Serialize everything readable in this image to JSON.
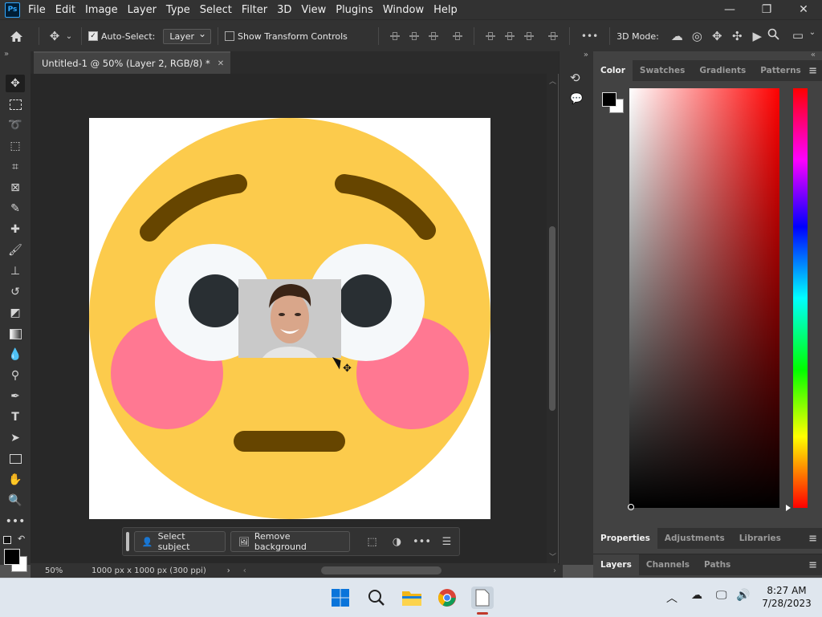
{
  "app": {
    "logo": "Ps",
    "menu": [
      "File",
      "Edit",
      "Image",
      "Layer",
      "Type",
      "Select",
      "Filter",
      "3D",
      "View",
      "Plugins",
      "Window",
      "Help"
    ],
    "window_controls": [
      "minimize-icon",
      "restore-icon",
      "close-icon"
    ]
  },
  "options_bar": {
    "auto_select_label": "Auto-Select:",
    "auto_select_checked": true,
    "auto_select_target": "Layer",
    "transform_controls_label": "Show Transform Controls",
    "transform_controls_checked": false,
    "more_label": "•••",
    "three_d_mode_label": "3D Mode:"
  },
  "document": {
    "tab_title": "Untitled-1 @ 50% (Layer 2, RGB/8) *",
    "zoom": "50%",
    "doc_info": "1000 px x 1000 px (300 ppi)"
  },
  "context_bar": {
    "select_subject": "Select subject",
    "remove_background": "Remove background",
    "more": "•••"
  },
  "panels": {
    "color_tabs": [
      "Color",
      "Swatches",
      "Gradients",
      "Patterns"
    ],
    "props_tabs": [
      "Properties",
      "Adjustments",
      "Libraries"
    ],
    "layers_tabs": [
      "Layers",
      "Channels",
      "Paths"
    ],
    "foreground_color": "#000000",
    "background_color": "#ffffff",
    "picker_hue": "#ff0000"
  },
  "taskbar": {
    "time": "8:27 AM",
    "date": "7/28/2023"
  },
  "colors": {
    "emoji_yellow": "#fccb4c",
    "brow_brown": "#664500",
    "cheek_pink": "#ff7892",
    "eye_white": "#f5f8fa",
    "pupil": "#292f33"
  }
}
